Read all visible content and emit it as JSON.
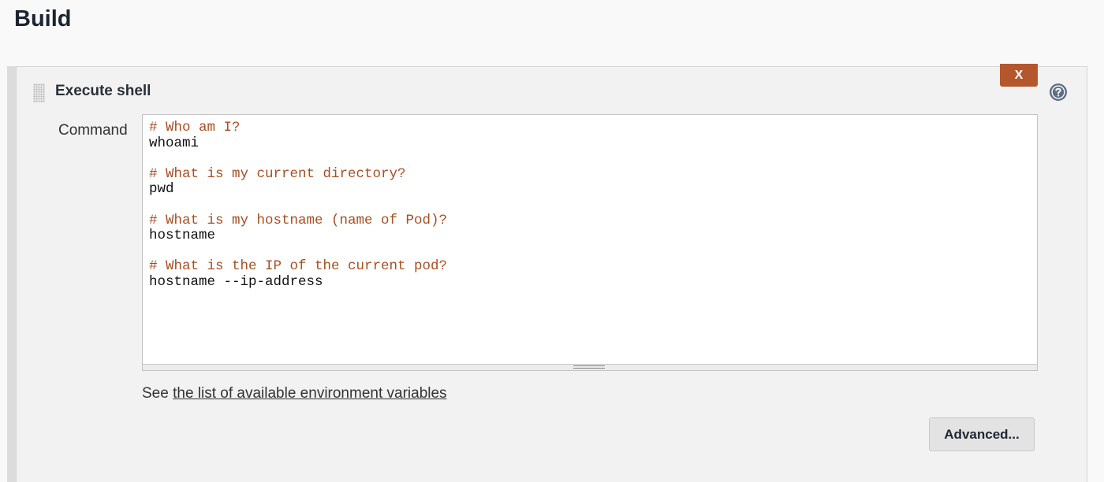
{
  "section": {
    "title": "Build"
  },
  "step": {
    "title": "Execute shell",
    "delete_label": "X",
    "help_icon": "question-mark-circle"
  },
  "command": {
    "label": "Command",
    "lines": [
      {
        "text": "# Who am I?",
        "kind": "comment"
      },
      {
        "text": "whoami",
        "kind": "code"
      },
      {
        "text": "",
        "kind": "blank"
      },
      {
        "text": "# What is my current directory?",
        "kind": "comment"
      },
      {
        "text": "pwd",
        "kind": "code"
      },
      {
        "text": "",
        "kind": "blank"
      },
      {
        "text": "# What is my hostname (name of Pod)?",
        "kind": "comment"
      },
      {
        "text": "hostname",
        "kind": "code"
      },
      {
        "text": "",
        "kind": "blank"
      },
      {
        "text": "# What is the IP of the current pod?",
        "kind": "comment"
      },
      {
        "text": "hostname --ip-address",
        "kind": "code"
      }
    ]
  },
  "env_hint": {
    "prefix": "See ",
    "link_text": "the list of available environment variables"
  },
  "advanced_label": "Advanced...",
  "colors": {
    "delete_button": "#b4572f",
    "comment_text": "#a84e21"
  }
}
